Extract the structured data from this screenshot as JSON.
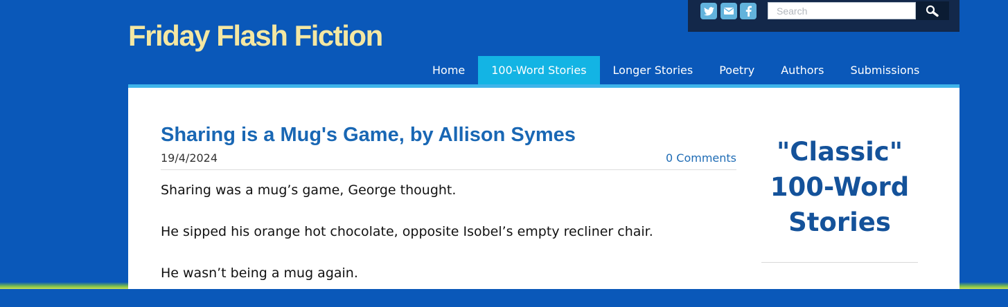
{
  "header": {
    "site_title": "Friday Flash Fiction",
    "search": {
      "placeholder": "Search"
    },
    "social_icons": [
      "twitter-icon",
      "email-icon",
      "facebook-icon"
    ]
  },
  "nav": {
    "items": [
      {
        "label": "Home",
        "active": false
      },
      {
        "label": "100-Word Stories",
        "active": true
      },
      {
        "label": "Longer Stories",
        "active": false
      },
      {
        "label": "Poetry",
        "active": false
      },
      {
        "label": "Authors",
        "active": false
      },
      {
        "label": "Submissions",
        "active": false
      }
    ]
  },
  "post": {
    "title": "Sharing is a Mug's Game, by Allison Symes",
    "date": "19/4/2024",
    "comments": "0 Comments",
    "paragraphs": [
      "Sharing was a mug’s game, George thought.",
      "He sipped his orange hot chocolate, opposite Isobel’s empty recliner chair.",
      "He wasn’t being a mug again."
    ]
  },
  "sidebar": {
    "heading": "\"Classic\" 100-Word Stories"
  },
  "colors": {
    "background": "#0a58b9",
    "title": "#f4e7a2",
    "nav_active": "#13b4e4",
    "link": "#1967b4",
    "sidebar_heading": "#14529a"
  }
}
